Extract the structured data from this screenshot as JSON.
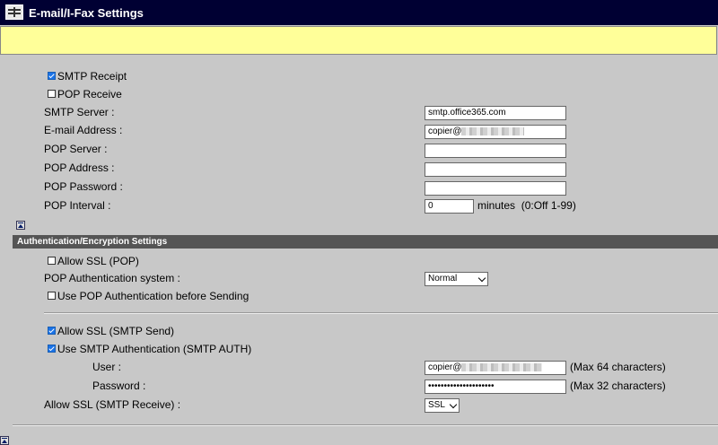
{
  "header": {
    "title": "E-mail/I-Fax Settings",
    "icon": "keyboard-icon"
  },
  "pop_smtp": {
    "smtp_receipt": {
      "label": "SMTP Receipt",
      "checked": true
    },
    "pop_receive": {
      "label": "POP Receive",
      "checked": false
    },
    "smtp_server": {
      "label": "SMTP Server :",
      "value": "smtp.office365.com"
    },
    "email_address": {
      "label": "E-mail Address :",
      "value": "copier@"
    },
    "pop_server": {
      "label": "POP Server :",
      "value": ""
    },
    "pop_address": {
      "label": "POP Address :",
      "value": ""
    },
    "pop_password": {
      "label": "POP Password :",
      "value": ""
    },
    "pop_interval": {
      "label": "POP Interval :",
      "value": "0",
      "unit": "minutes",
      "hint": "(0:Off 1-99)"
    }
  },
  "auth": {
    "section_title": "Authentication/Encryption Settings",
    "allow_ssl_pop": {
      "label": "Allow SSL (POP)",
      "checked": false
    },
    "pop_auth_system": {
      "label": "POP Authentication system :",
      "value": "Normal"
    },
    "use_pop_before_send": {
      "label": "Use POP Authentication before Sending",
      "checked": false
    },
    "allow_ssl_smtp_send": {
      "label": "Allow SSL (SMTP Send)",
      "checked": true
    },
    "use_smtp_auth": {
      "label": "Use SMTP Authentication (SMTP AUTH)",
      "checked": true
    },
    "user": {
      "label": "User :",
      "value": "copier@",
      "hint": "(Max 64 characters)"
    },
    "password": {
      "label": "Password :",
      "value": "•••••••••••••••••••••",
      "hint": "(Max 32 characters)"
    },
    "allow_ssl_smtp_receive": {
      "label": "Allow SSL (SMTP Receive) :",
      "value": "SSL"
    }
  }
}
